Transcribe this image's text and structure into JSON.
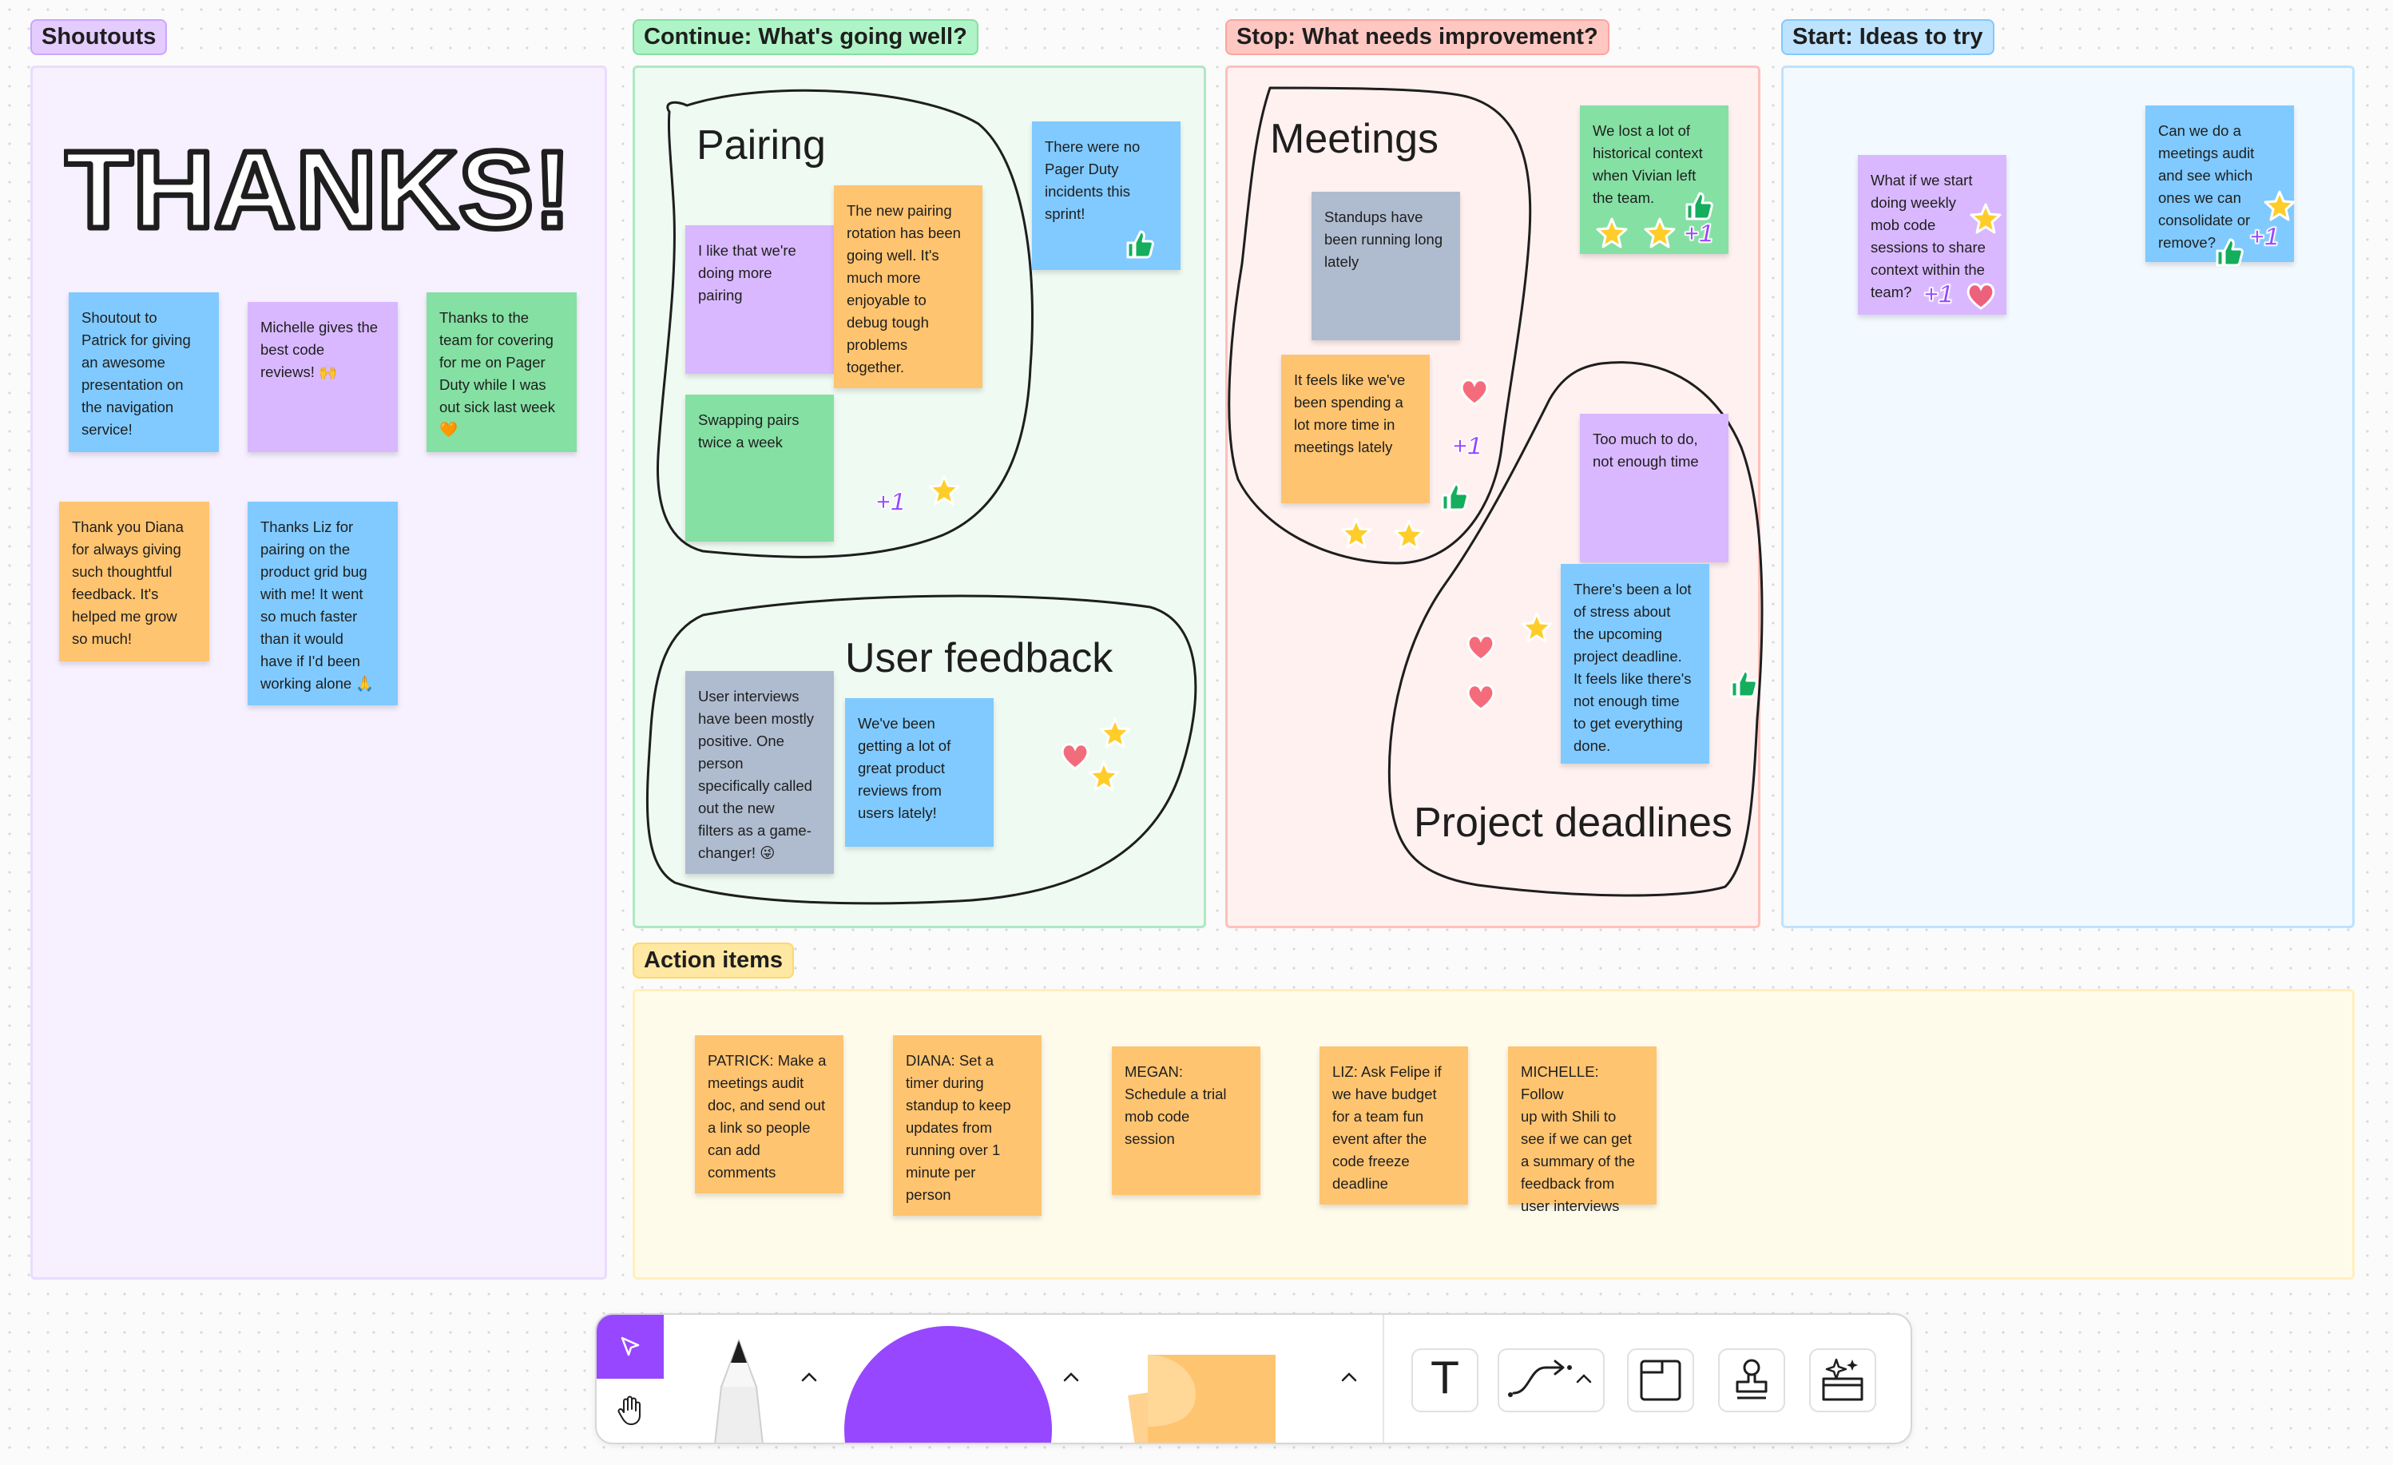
{
  "colors": {
    "sticky_yellow": "#ffc470",
    "sticky_blue": "#80caff",
    "sticky_purple": "#d9b8ff",
    "sticky_green": "#85e0a3",
    "sticky_gray": "#afbccf",
    "accent_purple": "#9747ff"
  },
  "sections": {
    "shoutouts": "Shoutouts",
    "continue": "Continue: What's going well?",
    "stop": "Stop: What needs improvement?",
    "start": "Start: Ideas to try",
    "action_items": "Action items"
  },
  "thanks_art": "THANKS!",
  "shoutout_notes": [
    "Shoutout to\nPatrick for giving\nan awesome\npresentation on\nthe navigation\nservice!",
    "Michelle gives the\nbest code\nreviews! 🙌",
    "Thanks to the\nteam for covering\nfor me on Pager\nDuty while I was\nout sick last week\n🧡",
    "Thank you Diana\nfor always giving\nsuch thoughtful\nfeedback. It's\nhelped me grow\nso much!",
    "Thanks Liz for\npairing on the\nproduct grid bug\nwith me! It went\nso much faster\nthan it would\nhave if I'd been\nworking alone 🙏"
  ],
  "continue_col": {
    "cluster_pairing": "Pairing",
    "cluster_user_feedback": "User feedback",
    "notes": [
      "I like that we're\ndoing more\npairing",
      "The new pairing\nrotation has been\ngoing well. It's\nmuch more\nenjoyable to\ndebug tough\nproblems\ntogether.",
      "Swapping pairs\ntwice a week",
      "There were no\nPager Duty\nincidents this\nsprint!",
      "User interviews\nhave been mostly\npositive. One\nperson\nspecifically called\nout the new\nfilters as a game-\nchanger! 😜",
      "We've been\ngetting a lot of\ngreat product\nreviews from\nusers lately!"
    ]
  },
  "stop_col": {
    "cluster_meetings": "Meetings",
    "cluster_project_deadlines": "Project deadlines",
    "notes": [
      "Standups have\nbeen running long\nlately",
      "It feels like we've\nbeen spending a\nlot more time in\nmeetings lately",
      "We lost a lot of\nhistorical context\nwhen Vivian left\nthe team.",
      "Too much to do,\nnot enough time",
      "There's been a lot\nof stress about\nthe upcoming\nproject deadline.\nIt feels like there's\nnot enough time\nto get everything\ndone."
    ]
  },
  "start_col": {
    "notes": [
      "What if we start\ndoing weekly\nmob code\nsessions to share\ncontext within the\nteam?",
      "Can we do a\nmeetings audit\nand see which\nones we can\nconsolidate or\nremove?"
    ]
  },
  "action_items": [
    "PATRICK: Make a\nmeetings audit\ndoc, and send out\na link so people\ncan add\ncomments",
    "DIANA: Set a\ntimer during\nstandup to keep\nupdates from\nrunning over 1\nminute per\nperson",
    "MEGAN:\nSchedule a trial\nmob code\nsession",
    "LIZ: Ask Felipe if\nwe have budget\nfor a team fun\nevent after the\ncode freeze\ndeadline",
    "MICHELLE: Follow\nup with Shili to\nsee if we can get\na summary of the\nfeedback from\nuser interviews"
  ],
  "sticker_text": {
    "plus_one": "+1"
  },
  "toolbar": {
    "tools": [
      "move-tool",
      "hand-tool",
      "pen-tool",
      "shape-tool",
      "sticky-note-tool",
      "text-tool",
      "connector-tool",
      "section-tool",
      "stamp-tool",
      "widget-tool"
    ],
    "text_tool_glyph": "T"
  }
}
